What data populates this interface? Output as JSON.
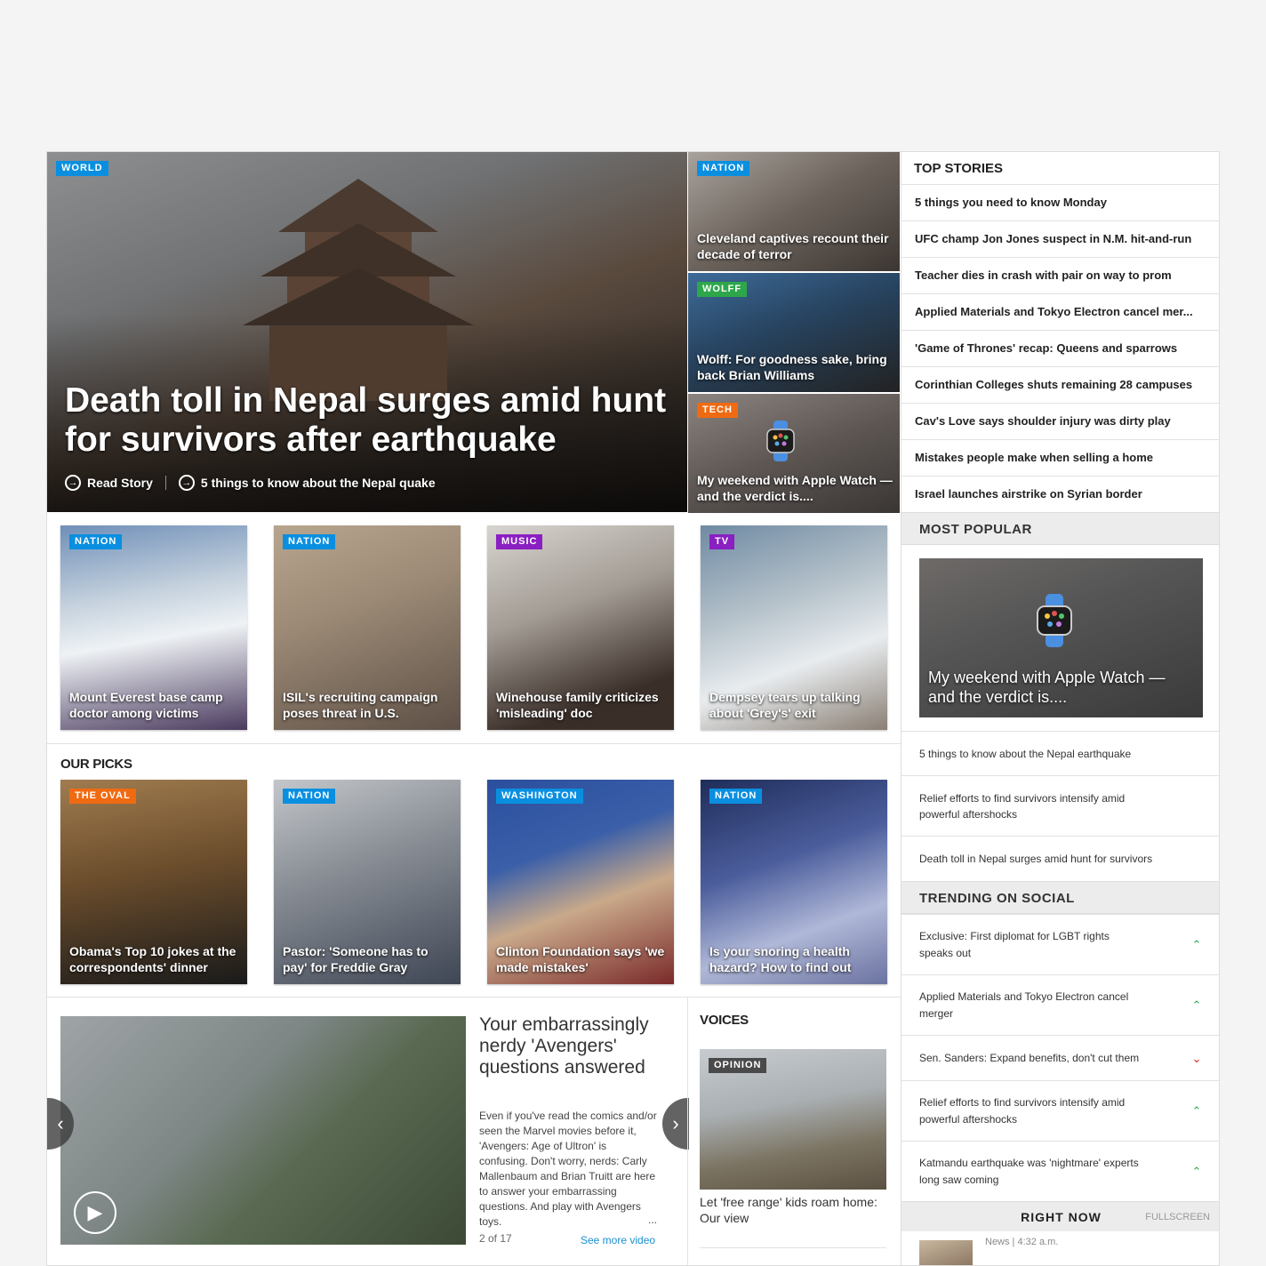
{
  "hero": {
    "tag": "WORLD",
    "title": "Death toll in Nepal surges amid hunt for survivors after earthquake",
    "link1": "Read Story",
    "link2": "5 things to know about the Nepal quake"
  },
  "side_stories": [
    {
      "tag": "NATION",
      "caption": "Cleveland captives recount their decade of terror"
    },
    {
      "tag": "WOLFF",
      "caption": "Wolff: For goodness sake, bring back Brian Williams"
    },
    {
      "tag": "TECH",
      "caption": "My weekend with Apple Watch — and the verdict is...."
    }
  ],
  "grid_top": [
    {
      "tag": "NATION",
      "caption": "Mount Everest base camp doctor among victims"
    },
    {
      "tag": "NATION",
      "caption": "ISIL's recruiting campaign poses threat in U.S."
    },
    {
      "tag": "MUSIC",
      "caption": "Winehouse family criticizes 'misleading' doc"
    },
    {
      "tag": "TV",
      "caption": "Dempsey tears up talking about 'Grey's' exit"
    }
  ],
  "our_picks": {
    "heading": "OUR PICKS",
    "items": [
      {
        "tag": "THE OVAL",
        "caption": "Obama's Top 10 jokes at the correspondents' dinner"
      },
      {
        "tag": "NATION",
        "caption": "Pastor: 'Someone has to pay' for Freddie Gray"
      },
      {
        "tag": "WASHINGTON",
        "caption": "Clinton Foundation says 'we made mistakes'"
      },
      {
        "tag": "NATION",
        "caption": "Is your snoring a health hazard? How to find out"
      }
    ]
  },
  "video": {
    "title": "Your embarrassingly nerdy 'Avengers' questions answered",
    "description": "Even if you've read the comics and/or seen the Marvel movies before it, 'Avengers: Age of Ultron' is confusing. Don't worry, nerds: Carly Mallenbaum and Brian Truitt are here to answer your embarrassing questions. And play with Avengers toys.",
    "ellipsis": "...",
    "count": "2 of 17",
    "see_more": "See more video",
    "prev_icon": "‹",
    "next_icon": "›",
    "play_icon": "▶"
  },
  "voices": {
    "heading": "VOICES",
    "tag": "OPINION",
    "caption": "Let 'free range' kids roam home: Our view"
  },
  "rail": {
    "top_stories_heading": "TOP STORIES",
    "top_stories": [
      "5 things you need to know Monday",
      "UFC champ Jon Jones suspect in N.M. hit-and-run",
      "Teacher dies in crash with pair on way to prom",
      "Applied Materials and Tokyo Electron cancel mer...",
      "'Game of Thrones' recap: Queens and sparrows",
      "Corinthian Colleges shuts remaining 28 campuses",
      "Cav's Love says shoulder injury was dirty play",
      "Mistakes people make when selling a home",
      "Israel launches airstrike on Syrian border"
    ],
    "most_popular_heading": "MOST POPULAR",
    "most_popular_feature": "My weekend with Apple Watch — and the verdict is....",
    "most_popular": [
      "5 things to know about the Nepal earthquake",
      "Relief efforts to find survivors intensify amid powerful aftershocks",
      "Death toll in Nepal surges amid hunt for survivors"
    ],
    "trending_heading": "TRENDING ON SOCIAL",
    "trending": [
      {
        "text": "Exclusive: First diplomat for LGBT rights speaks out",
        "dir": "up",
        "icon": "⌃"
      },
      {
        "text": "Applied Materials and Tokyo Electron cancel merger",
        "dir": "up",
        "icon": "⌃"
      },
      {
        "text": "Sen. Sanders: Expand benefits, don't cut them",
        "dir": "down",
        "icon": "⌄"
      },
      {
        "text": "Relief efforts to find survivors intensify amid powerful aftershocks",
        "dir": "up",
        "icon": "⌃"
      },
      {
        "text": "Katmandu earthquake was 'nightmare' experts long saw coming",
        "dir": "up",
        "icon": "⌃"
      }
    ],
    "right_now": "RIGHT NOW",
    "fullscreen": "FULLSCREEN",
    "right_now_meta": "News | 4:32 a.m."
  },
  "colors": {
    "tag_blue": "#0a8fe0",
    "tag_green": "#2da74a",
    "tag_orange": "#f06a12",
    "tag_purple": "#8a1fc2",
    "link_blue": "#1a8fcf"
  }
}
